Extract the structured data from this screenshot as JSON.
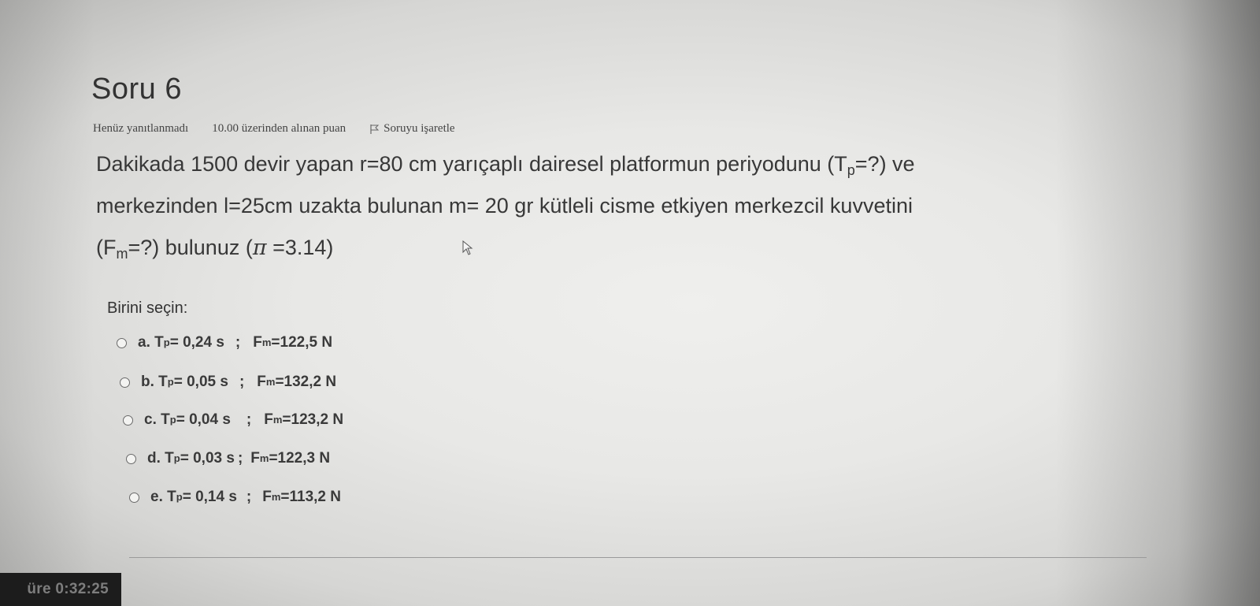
{
  "question": {
    "title": "Soru 6",
    "state": "Henüz yanıtlanmadı",
    "grade": "10.00 üzerinden alınan puan",
    "flag_label": "Soruyu işaretle",
    "flag_icon": "flag-icon",
    "text": {
      "l1_a": "Dakikada 1500 devir yapan  r=80 cm  yarıçaplı dairesel platformun periyodunu (T",
      "l1_sub": "p",
      "l1_b": "=?) ve",
      "l2": "merkezinden  l=25cm uzakta bulunan  m= 20 gr kütleli cisme etkiyen merkezcil kuvvetini",
      "l3_a": "(F",
      "l3_sub": "m",
      "l3_b": "=?) bulunuz (",
      "l3_pi": "π",
      "l3_c": " =3.14)"
    }
  },
  "prompt": "Birini seçin:",
  "answers": [
    {
      "letter": "a.",
      "t": "T",
      "tsub": "p",
      "tval": "= 0,24 s",
      "sep": ";",
      "f": "F",
      "fsub": "m",
      "fval": "=122,5 N"
    },
    {
      "letter": "b.",
      "t": "T",
      "tsub": "p",
      "tval": "= 0,05 s",
      "sep": ";",
      "f": "F",
      "fsub": "m",
      "fval": "=132,2 N"
    },
    {
      "letter": "c.",
      "t": "T",
      "tsub": "p",
      "tval": "= 0,04 s",
      "sep": ";",
      "f": "F",
      "fsub": "m",
      "fval": "=123,2 N"
    },
    {
      "letter": "d.",
      "t": "T",
      "tsub": "p",
      "tval": "= 0,03 s",
      "sep": ";",
      "f": "F",
      "fsub": "m",
      "fval": "=122,3 N"
    },
    {
      "letter": "e.",
      "t": "T",
      "tsub": "p",
      "tval": "= 0,14 s",
      "sep": ";",
      "f": "F",
      "fsub": "m",
      "fval": "=113,2 N"
    }
  ],
  "timer": {
    "label": "üre 0:32:25"
  },
  "colors": {
    "text": "#3a3a3a",
    "timer_bg": "#1c1c1c"
  }
}
